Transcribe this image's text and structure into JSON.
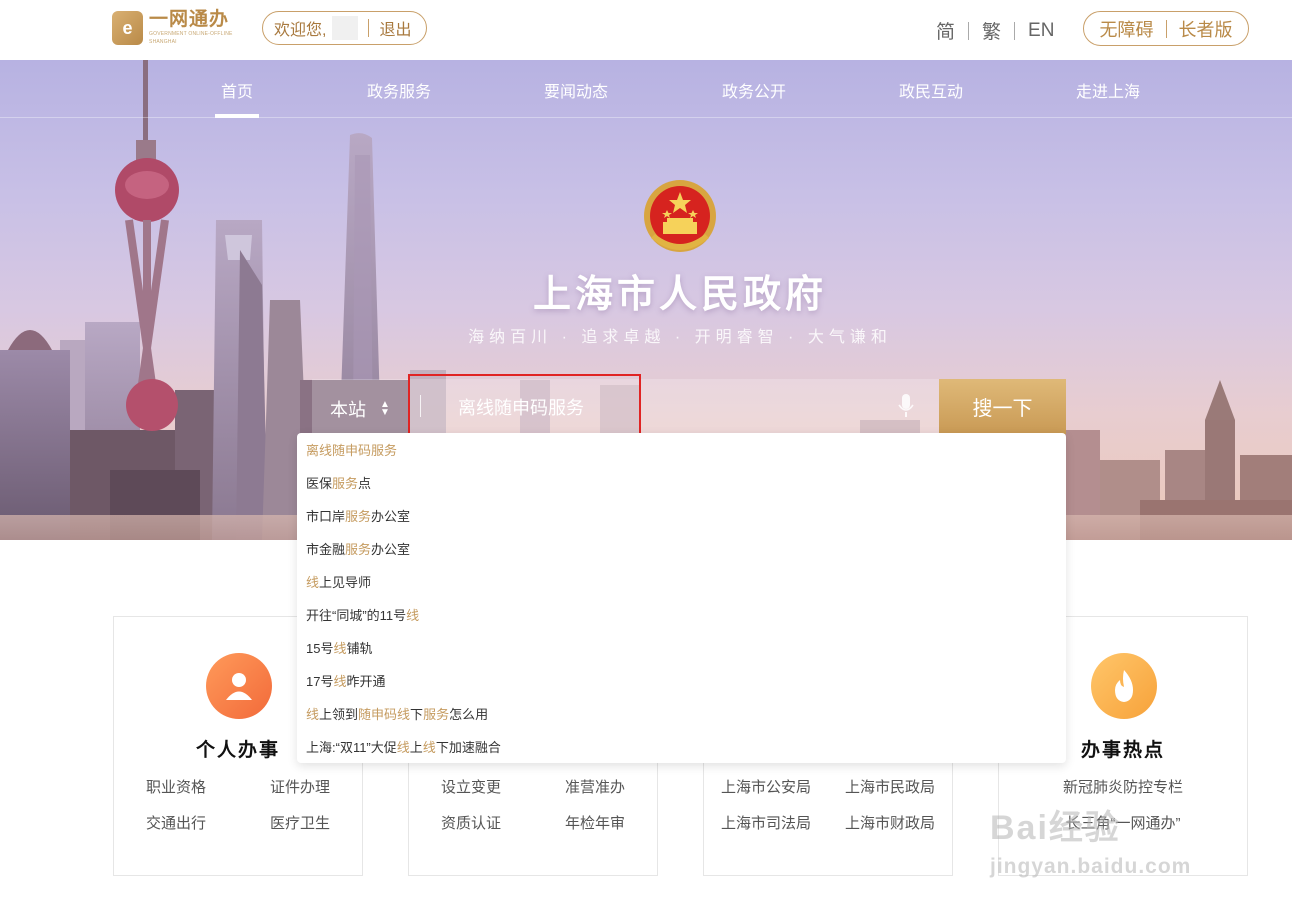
{
  "header": {
    "logo_text": "一网通办",
    "logo_subtext": "GOVERNMENT ONLINE-OFFLINE SHANGHAI",
    "welcome": "欢迎您,",
    "logout": "退出",
    "lang_simplified": "简",
    "lang_traditional": "繁",
    "lang_english": "EN",
    "accessibility": "无障碍",
    "elderly": "长者版"
  },
  "nav": {
    "items": [
      "首页",
      "政务服务",
      "要闻动态",
      "政务公开",
      "政民互动",
      "走进上海"
    ],
    "active_index": 0
  },
  "hero": {
    "title": "上海市人民政府",
    "motto": "海纳百川 · 追求卓越 · 开明睿智 · 大气谦和"
  },
  "search": {
    "scope": "本站",
    "value": "离线随申码服务",
    "button": "搜一下"
  },
  "suggestions": [
    [
      {
        "t": "离线随申码服务",
        "h": true
      }
    ],
    [
      {
        "t": "医保"
      },
      {
        "t": "服务",
        "h": true
      },
      {
        "t": "点"
      }
    ],
    [
      {
        "t": "市口岸"
      },
      {
        "t": "服务",
        "h": true
      },
      {
        "t": "办公室"
      }
    ],
    [
      {
        "t": "市金融"
      },
      {
        "t": "服务",
        "h": true
      },
      {
        "t": "办公室"
      }
    ],
    [
      {
        "t": "线",
        "h": true
      },
      {
        "t": "上见导师"
      }
    ],
    [
      {
        "t": "开往“同城”的11号"
      },
      {
        "t": "线",
        "h": true
      }
    ],
    [
      {
        "t": "15号"
      },
      {
        "t": "线",
        "h": true
      },
      {
        "t": "铺轨"
      }
    ],
    [
      {
        "t": "17号"
      },
      {
        "t": "线",
        "h": true
      },
      {
        "t": "昨开通"
      }
    ],
    [
      {
        "t": "线",
        "h": true
      },
      {
        "t": "上领到"
      },
      {
        "t": "随申码线",
        "h": true
      },
      {
        "t": "下"
      },
      {
        "t": "服务",
        "h": true
      },
      {
        "t": "怎么用"
      }
    ],
    [
      {
        "t": "上海:“双11”大促"
      },
      {
        "t": "线",
        "h": true
      },
      {
        "t": "上"
      },
      {
        "t": "线",
        "h": true
      },
      {
        "t": "下加速融合"
      }
    ]
  ],
  "cards": {
    "personal": {
      "title": "个人办事",
      "links": [
        "职业资格",
        "证件办理",
        "交通出行",
        "医疗卫生"
      ]
    },
    "corporate": {
      "links": [
        "设立变更",
        "准营准办",
        "资质认证",
        "年检年审"
      ]
    },
    "departments": {
      "links": [
        "上海市公安局",
        "上海市民政局",
        "上海市司法局",
        "上海市财政局"
      ]
    },
    "hot": {
      "title": "办事热点",
      "links": [
        "新冠肺炎防控专栏",
        "长三角“一网通办”"
      ]
    }
  },
  "watermark": {
    "line1": "Bai经验",
    "line2": "jingyan.baidu.com"
  },
  "colors": {
    "gold": "#c9a06a",
    "highlight": "#c59b5f",
    "red_box": "#e02424"
  }
}
